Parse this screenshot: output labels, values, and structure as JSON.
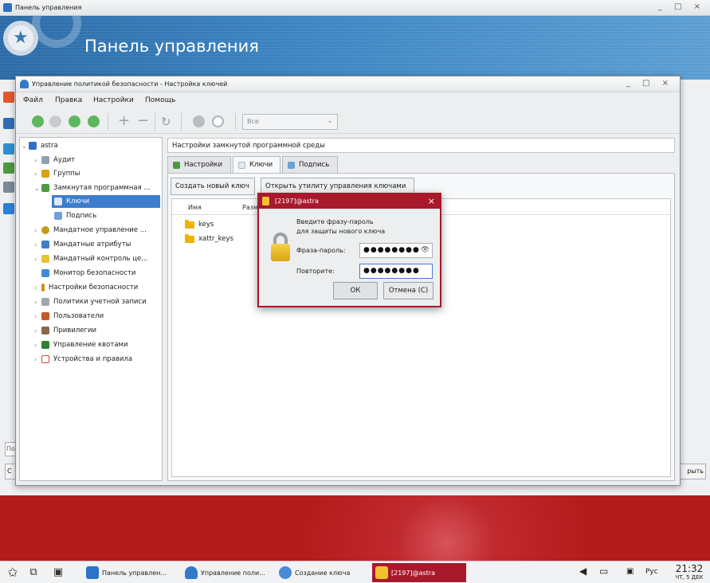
{
  "outer_window": {
    "title": "Панель управления",
    "controls": "_ □ ×",
    "banner_title": "Панель управления",
    "search_placeholder": "По",
    "left_button": "С",
    "right_button": "рыть"
  },
  "security_window": {
    "title": "Управление политикой безопасности - Настройка ключей",
    "controls": "_ □ ×",
    "menu": [
      "Файл",
      "Правка",
      "Настройки",
      "Помощь"
    ],
    "toolbar": {
      "filter_value": "Все"
    },
    "tree": [
      {
        "label": "astra",
        "icon": "computer-icon"
      },
      {
        "label": "Аудит",
        "icon": "audit-icon"
      },
      {
        "label": "Группы",
        "icon": "groups-icon"
      },
      {
        "label": "Замкнутая программная ...",
        "icon": "closed-env-icon"
      },
      {
        "label": "Ключи",
        "icon": "key-icon"
      },
      {
        "label": "Подпись",
        "icon": "signature-icon"
      },
      {
        "label": "Мандатное управление ...",
        "icon": "mandatory-control-icon"
      },
      {
        "label": "Мандатные атрибуты",
        "icon": "mandatory-attributes-icon"
      },
      {
        "label": "Мандатный контроль це...",
        "icon": "integrity-control-icon"
      },
      {
        "label": "Монитор безопасности",
        "icon": "monitor-icon"
      },
      {
        "label": "Настройки безопасности",
        "icon": "security-settings-icon"
      },
      {
        "label": "Политики учетной записи",
        "icon": "account-policy-icon"
      },
      {
        "label": "Пользователи",
        "icon": "users-icon"
      },
      {
        "label": "Привилегии",
        "icon": "privileges-icon"
      },
      {
        "label": "Управление квотами",
        "icon": "quota-icon"
      },
      {
        "label": "Устройства и правила",
        "icon": "devices-icon"
      }
    ],
    "panel_header": "Настройки замкнутой программной среды",
    "tabs": [
      "Настройки",
      "Ключи",
      "Подпись"
    ],
    "buttons": {
      "create_key": "Создать новый ключ",
      "open_utility": "Открыть утилиту управления ключами"
    },
    "file_list": {
      "columns": [
        "Имя",
        "Разм"
      ],
      "rows": [
        "keys",
        "xattr_keys"
      ]
    }
  },
  "passphrase_dialog": {
    "title": "[2197]@astra",
    "close": "×",
    "prompt_line1": "Введите фразу-пароль",
    "prompt_line2": "для защиты нового ключа",
    "passphrase_label": "Фраза-пароль:",
    "passphrase_value": "●●●●●●●●",
    "repeat_label": "Повторите:",
    "repeat_value": "●●●●●●●●",
    "ok_label": "ОК",
    "cancel_label": "Отмена (С)"
  },
  "taskbar": {
    "tasks": [
      {
        "label": "Панель управлен...",
        "icon": "control-panel-icon"
      },
      {
        "label": "Управление поли...",
        "icon": "shield-icon"
      },
      {
        "label": "Создание ключа",
        "icon": "key-creation-icon"
      },
      {
        "label": "[2197]@astra",
        "icon": "lock-icon"
      }
    ],
    "language": "Рус",
    "time": "21:32",
    "date": "ЧТ, 5 ДЕК"
  },
  "colors": {
    "accent_red": "#a8192c",
    "selection_blue": "#3d7dcd",
    "banner_blue": "#3f87c4"
  }
}
